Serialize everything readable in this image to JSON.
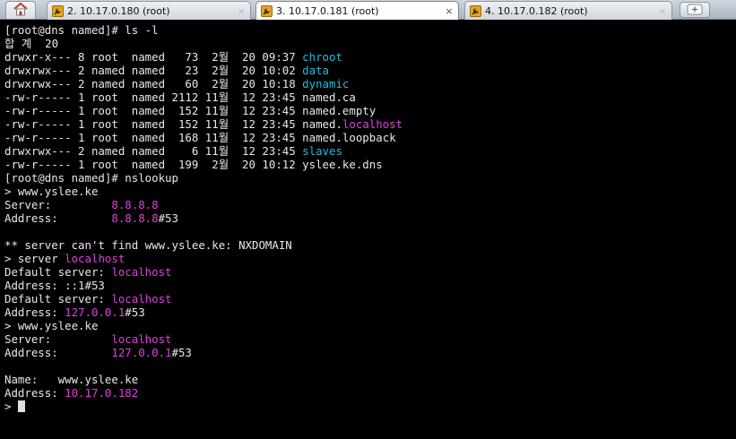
{
  "tabs": [
    {
      "label": "2. 10.17.0.180 (root)",
      "active": false
    },
    {
      "label": "3. 10.17.0.181 (root)",
      "active": true
    },
    {
      "label": "4. 10.17.0.182 (root)",
      "active": false
    }
  ],
  "tab_close_glyph": "×",
  "icons": {
    "home": "home-icon",
    "tab": "wrench-icon",
    "new_tab": "new-tab-icon"
  },
  "colors": {
    "directory": "#29b8db",
    "highlight": "#e040e0",
    "text": "#e8e8e8",
    "background": "#000000"
  },
  "terminal": {
    "lines": [
      [
        {
          "t": "[root@dns named]# ls -l"
        }
      ],
      [
        {
          "t": "합 계  20"
        }
      ],
      [
        {
          "t": "drwxr-x--- 8 root  named   73  2월  20 09:37 "
        },
        {
          "t": "chroot",
          "c": "cyan"
        }
      ],
      [
        {
          "t": "drwxrwx--- 2 named named   23  2월  20 10:02 "
        },
        {
          "t": "data",
          "c": "cyan"
        }
      ],
      [
        {
          "t": "drwxrwx--- 2 named named   60  2월  20 10:18 "
        },
        {
          "t": "dynamic",
          "c": "cyan"
        }
      ],
      [
        {
          "t": "-rw-r----- 1 root  named 2112 11월  12 23:45 named.ca"
        }
      ],
      [
        {
          "t": "-rw-r----- 1 root  named  152 11월  12 23:45 named.empty"
        }
      ],
      [
        {
          "t": "-rw-r----- 1 root  named  152 11월  12 23:45 named."
        },
        {
          "t": "localhost",
          "c": "mag"
        }
      ],
      [
        {
          "t": "-rw-r----- 1 root  named  168 11월  12 23:45 named.loopback"
        }
      ],
      [
        {
          "t": "drwxrwx--- 2 named named    6 11월  12 23:45 "
        },
        {
          "t": "slaves",
          "c": "cyan"
        }
      ],
      [
        {
          "t": "-rw-r----- 1 root  named  199  2월  20 10:12 yslee.ke.dns"
        }
      ],
      [
        {
          "t": "[root@dns named]# nslookup"
        }
      ],
      [
        {
          "t": "> www.yslee.ke"
        }
      ],
      [
        {
          "t": "Server:         "
        },
        {
          "t": "8.8.8.8",
          "c": "mag"
        }
      ],
      [
        {
          "t": "Address:        "
        },
        {
          "t": "8.8.8.8",
          "c": "mag"
        },
        {
          "t": "#53"
        }
      ],
      [
        {
          "t": ""
        }
      ],
      [
        {
          "t": "** server can't find www.yslee.ke: NXDOMAIN"
        }
      ],
      [
        {
          "t": "> server "
        },
        {
          "t": "localhost",
          "c": "mag"
        }
      ],
      [
        {
          "t": "Default server: "
        },
        {
          "t": "localhost",
          "c": "mag"
        }
      ],
      [
        {
          "t": "Address: ::1#53"
        }
      ],
      [
        {
          "t": "Default server: "
        },
        {
          "t": "localhost",
          "c": "mag"
        }
      ],
      [
        {
          "t": "Address: "
        },
        {
          "t": "127.0.0.1",
          "c": "mag"
        },
        {
          "t": "#53"
        }
      ],
      [
        {
          "t": "> www.yslee.ke"
        }
      ],
      [
        {
          "t": "Server:         "
        },
        {
          "t": "localhost",
          "c": "mag"
        }
      ],
      [
        {
          "t": "Address:        "
        },
        {
          "t": "127.0.0.1",
          "c": "mag"
        },
        {
          "t": "#53"
        }
      ],
      [
        {
          "t": ""
        }
      ],
      [
        {
          "t": "Name:   www.yslee.ke"
        }
      ],
      [
        {
          "t": "Address: "
        },
        {
          "t": "10.17.0.182",
          "c": "mag"
        }
      ],
      [
        {
          "t": "> "
        },
        {
          "t": "",
          "c": "cursor"
        }
      ]
    ]
  }
}
